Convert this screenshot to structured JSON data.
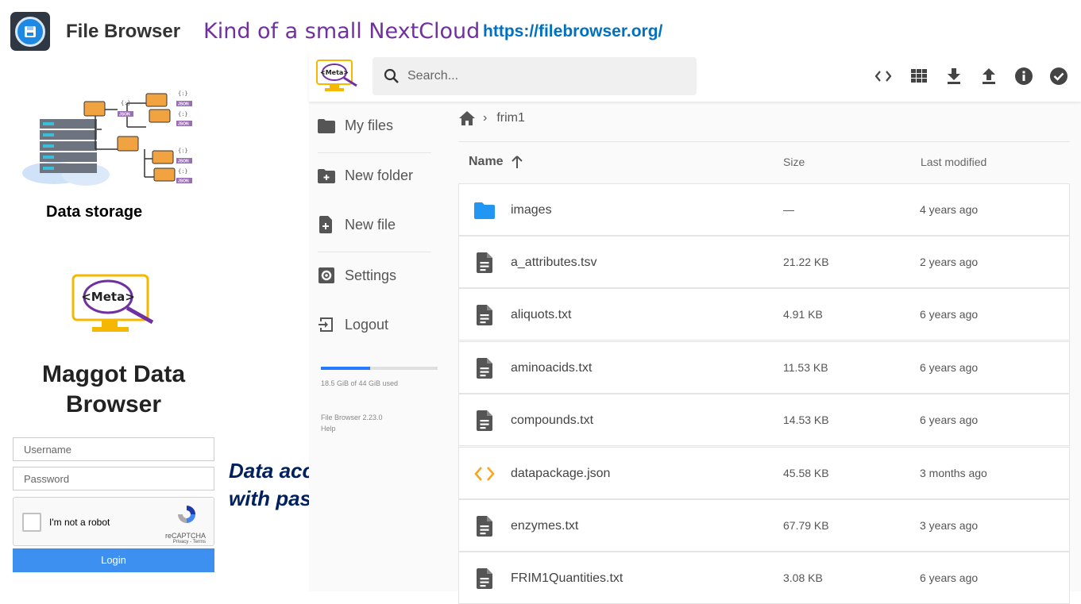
{
  "header": {
    "app_title": "File Browser",
    "tagline": "Kind of a small NextCloud",
    "url": "https://filebrowser.org/"
  },
  "left_panel": {
    "storage_caption": "Data storage",
    "storage_art_labels": [
      "{:}",
      "JSON"
    ],
    "logo_text": "<Meta>",
    "app_name": "Maggot Data Browser",
    "username_placeholder": "Username",
    "password_placeholder": "Password",
    "captcha_label": "I'm not a robot",
    "captcha_brand": "reCAPTCHA",
    "captcha_links": "Privacy - Terms",
    "login_label": "Login",
    "note": "Data accessible with password"
  },
  "filebrowser": {
    "logo_text": "<Meta>",
    "search_placeholder": "Search...",
    "toolbar": [
      "code-view-icon",
      "grid-view-icon",
      "download-icon",
      "upload-icon",
      "info-icon",
      "select-all-icon"
    ],
    "sidebar": {
      "my_files": "My files",
      "new_folder": "New folder",
      "new_file": "New file",
      "settings": "Settings",
      "logout": "Logout"
    },
    "quota_text": "18.5 GiB of 44 GiB used",
    "quota_fraction": 0.42,
    "version": "File Browser 2.23.0",
    "help": "Help",
    "breadcrumb": [
      "frim1"
    ],
    "columns": {
      "name": "Name",
      "size": "Size",
      "modified": "Last modified"
    },
    "files": [
      {
        "name": "images",
        "size": "—",
        "modified": "4 years ago",
        "type": "folder"
      },
      {
        "name": "a_attributes.tsv",
        "size": "21.22 KB",
        "modified": "2 years ago",
        "type": "file"
      },
      {
        "name": "aliquots.txt",
        "size": "4.91 KB",
        "modified": "6 years ago",
        "type": "file"
      },
      {
        "name": "aminoacids.txt",
        "size": "11.53 KB",
        "modified": "6 years ago",
        "type": "file"
      },
      {
        "name": "compounds.txt",
        "size": "14.53 KB",
        "modified": "6 years ago",
        "type": "file"
      },
      {
        "name": "datapackage.json",
        "size": "45.58 KB",
        "modified": "3 months ago",
        "type": "code"
      },
      {
        "name": "enzymes.txt",
        "size": "67.79 KB",
        "modified": "3 years ago",
        "type": "file"
      },
      {
        "name": "FRIM1Quantities.txt",
        "size": "3.08 KB",
        "modified": "6 years ago",
        "type": "file"
      }
    ]
  },
  "colors": {
    "accent": "#2979ff",
    "tagline": "#7030a0",
    "url": "#0070c0",
    "note": "#002060",
    "folder": "#2196f3",
    "code": "#f5a623"
  }
}
